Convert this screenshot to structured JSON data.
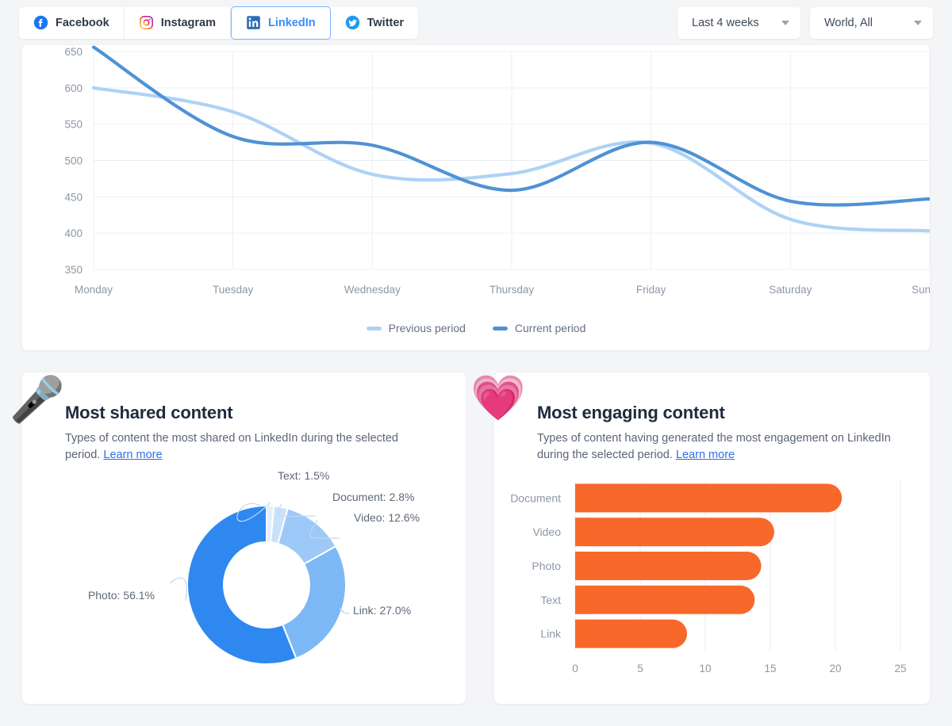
{
  "tabs": [
    {
      "label": "Facebook",
      "icon": "facebook-icon",
      "active": false
    },
    {
      "label": "Instagram",
      "icon": "instagram-icon",
      "active": false
    },
    {
      "label": "LinkedIn",
      "icon": "linkedin-icon",
      "active": true
    },
    {
      "label": "Twitter",
      "icon": "twitter-icon",
      "active": false
    }
  ],
  "selectors": {
    "period": "Last 4 weeks",
    "region": "World, All"
  },
  "cards": {
    "shared": {
      "emoji": "microphone-emoji",
      "title": "Most shared content",
      "description": "Types of content the most shared on LinkedIn during the",
      "description2": "selected period.",
      "learn_more": "Learn more"
    },
    "engaging": {
      "emoji": "heart-emoji",
      "title": "Most engaging content",
      "description": "Types of content having generated the most engagement on",
      "description2": "LinkedIn during the selected period.",
      "learn_more": "Learn more"
    }
  },
  "chart_data": [
    {
      "id": "followers-line",
      "type": "line",
      "title": "",
      "xlabel": "",
      "ylabel": "",
      "categories": [
        "Monday",
        "Tuesday",
        "Wednesday",
        "Thursday",
        "Friday",
        "Saturday",
        "Sunday"
      ],
      "ylim": [
        350,
        650
      ],
      "yticks": [
        350,
        400,
        450,
        500,
        550,
        600,
        650
      ],
      "grid": true,
      "legend_position": "bottom",
      "series": [
        {
          "name": "Previous period",
          "color": "#aed2f5",
          "values": [
            600,
            567,
            481,
            482,
            524,
            419,
            403
          ]
        },
        {
          "name": "Current period",
          "color": "#4f92d4",
          "values": [
            656,
            533,
            521,
            459,
            525,
            444,
            447
          ]
        }
      ]
    },
    {
      "id": "most-shared-donut",
      "type": "pie",
      "title": "",
      "labels": [
        "Text",
        "Document",
        "Video",
        "Link",
        "Photo"
      ],
      "values": [
        1.5,
        2.8,
        12.6,
        27.0,
        56.1
      ],
      "value_labels": [
        "Text: 1.5%",
        "Document: 2.8%",
        "Video: 12.6%",
        "Link: 27.0%",
        "Photo: 56.1%"
      ],
      "colors": [
        "#e2effd",
        "#c9e1fb",
        "#9cc9f8",
        "#7cb8f6",
        "#2f88f0"
      ],
      "donut": true
    },
    {
      "id": "most-engaging-bars",
      "type": "bar",
      "orientation": "horizontal",
      "title": "",
      "categories": [
        "Document",
        "Video",
        "Photo",
        "Text",
        "Link"
      ],
      "values": [
        20.5,
        15.3,
        14.3,
        13.8,
        8.6
      ],
      "xlim": [
        0,
        25
      ],
      "xticks": [
        0,
        5,
        10,
        15,
        20,
        25
      ],
      "color": "#f8682a",
      "grid": true
    }
  ]
}
